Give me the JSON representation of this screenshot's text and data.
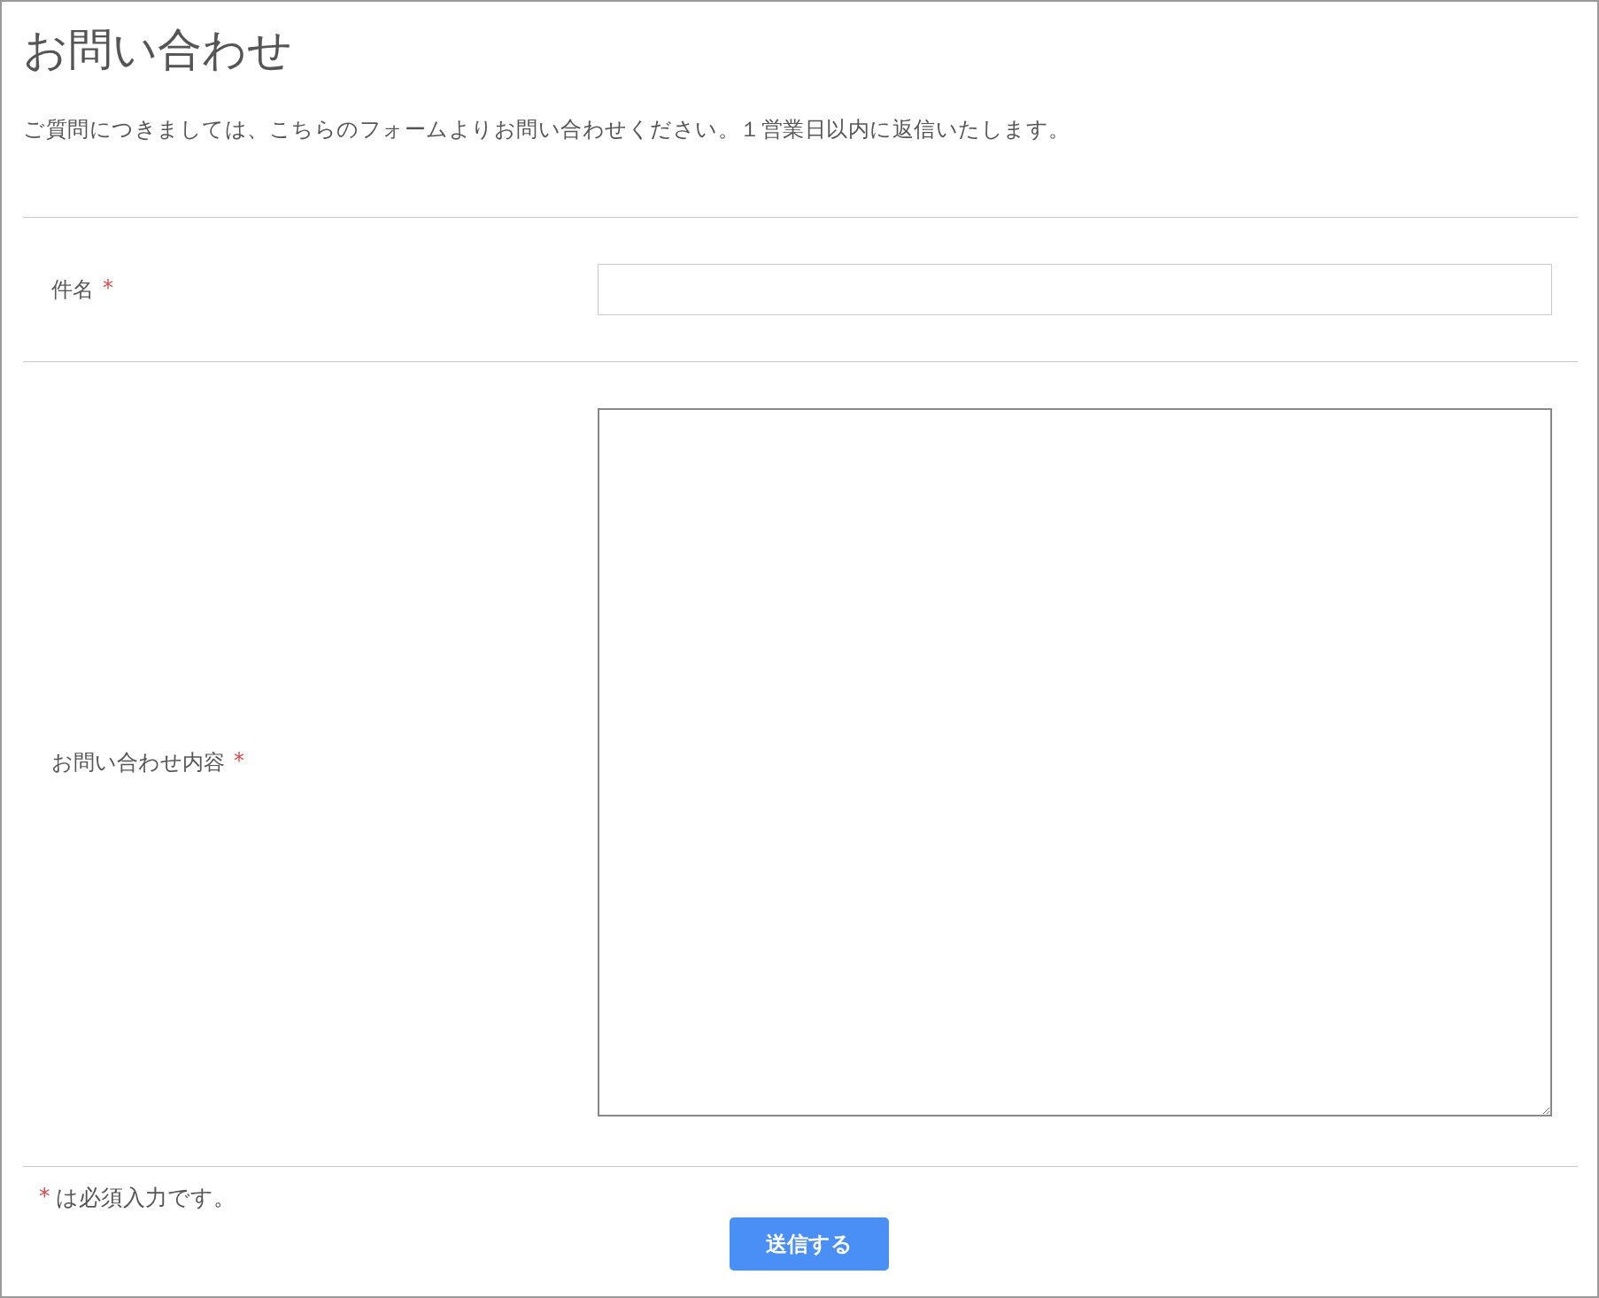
{
  "title": "お問い合わせ",
  "description": "ご質問につきましては、こちらのフォームよりお問い合わせください。１営業日以内に返信いたします。",
  "fields": [
    {
      "label": "件名",
      "required_mark": "*",
      "kind": "text"
    },
    {
      "label": "お問い合わせ内容",
      "required_mark": "*",
      "kind": "textarea"
    }
  ],
  "required_note": {
    "mark": "*",
    "text": "は必須入力です。"
  },
  "submit_button": "送信する"
}
